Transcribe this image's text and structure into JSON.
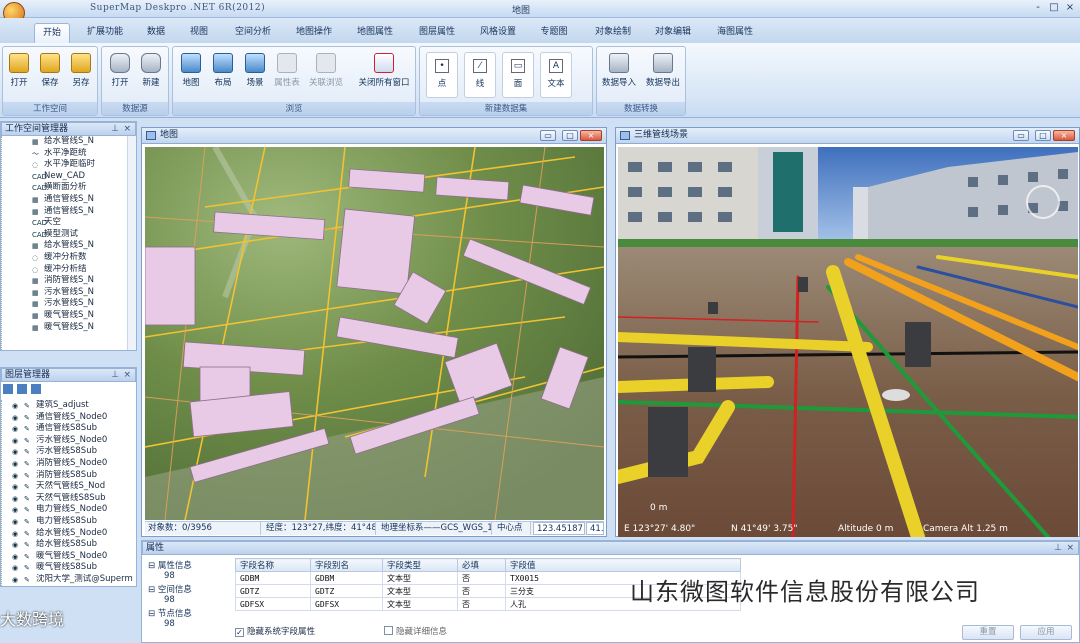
{
  "app": {
    "title": "SuperMap Deskpro .NET 6R(2012)",
    "document": "地图"
  },
  "window_controls": [
    "-",
    "□",
    "×"
  ],
  "menu_tabs": [
    "开始",
    "扩展功能",
    "数据",
    "视图",
    "空间分析",
    "地图操作",
    "地图属性",
    "图层属性",
    "风格设置",
    "专题图",
    "对象绘制",
    "对象编辑",
    "海图属性"
  ],
  "ribbon": {
    "workspace": {
      "label": "工作空间",
      "buttons": [
        "打开",
        "保存",
        "另存"
      ]
    },
    "datasource": {
      "label": "数据源",
      "buttons": [
        "打开",
        "新建"
      ]
    },
    "browse": {
      "label": "浏览",
      "buttons": [
        "地图",
        "布局",
        "场景",
        "属性表",
        "关联浏览",
        "关闭所有窗口"
      ]
    },
    "new_dataset": {
      "label": "新建数据集",
      "buttons": [
        "点",
        "线",
        "面",
        "文本"
      ],
      "icons": [
        "•",
        "⁄",
        "▭",
        "A"
      ]
    },
    "data_convert": {
      "label": "数据转换",
      "buttons": [
        "数据导入",
        "数据导出"
      ]
    }
  },
  "workspace_panel": {
    "title": "工作空间管理器",
    "items": [
      {
        "icon": "▦",
        "label": "给水管线S_N"
      },
      {
        "icon": "〜",
        "label": "水平净距统"
      },
      {
        "icon": "◌",
        "label": "水平净距临时"
      },
      {
        "icon": "CAD",
        "label": "New_CAD"
      },
      {
        "icon": "CAD",
        "label": "横断面分析"
      },
      {
        "icon": "▦",
        "label": "通信管线S_N"
      },
      {
        "icon": "▦",
        "label": "通信管线S_N"
      },
      {
        "icon": "CAD",
        "label": "天空"
      },
      {
        "icon": "CAD",
        "label": "模型测试"
      },
      {
        "icon": "▦",
        "label": "给水管线S_N"
      },
      {
        "icon": "◌",
        "label": "缓冲分析数"
      },
      {
        "icon": "◌",
        "label": "缓冲分析结"
      },
      {
        "icon": "▦",
        "label": "消防管线S_N"
      },
      {
        "icon": "▦",
        "label": "污水管线S_N"
      },
      {
        "icon": "▦",
        "label": "污水管线S_N"
      },
      {
        "icon": "▦",
        "label": "暖气管线S_N"
      },
      {
        "icon": "▦",
        "label": "暖气管线S_N"
      }
    ]
  },
  "layer_panel": {
    "title": "图层管理器",
    "items": [
      "建筑S_adjust",
      "通信管线S_Node0",
      "通信管线S8Sub",
      "污水管线S_Node0",
      "污水管线S8Sub",
      "消防管线S_Node0",
      "消防管线S8Sub",
      "天然气管线S_Nod",
      "天然气管线S8Sub",
      "电力管线S_Node0",
      "电力管线S8Sub",
      "给水管线S_Node0",
      "给水管线S8Sub",
      "暖气管线S_Node0",
      "暖气管线S8Sub",
      "沈阳大学_测试@Superm"
    ]
  },
  "map_window": {
    "title": "地图",
    "status": {
      "count_label": "对象数：",
      "count": "0/3956",
      "coords": "经度：123°27,纬度：41°48",
      "crs_label": "地理坐标系——GCS_WGS_19",
      "center_label": "中心点",
      "center_val": "123.45187190",
      "extra": "41.8"
    }
  },
  "scene_window": {
    "title": "三维管线场景",
    "hud": {
      "scale": "0 m",
      "lon": "E 123°27' 4.80\"",
      "lat": "N 41°49' 3.75\"",
      "alt": "Altitude 0 m",
      "cam": "Camera Alt 1.25 m"
    }
  },
  "attr_panel": {
    "title": "属性",
    "tree": [
      {
        "label": "属性信息",
        "value": "98"
      },
      {
        "label": "空间信息",
        "value": "98"
      },
      {
        "label": "节点信息",
        "value": "98"
      }
    ],
    "columns": [
      "字段名称",
      "字段别名",
      "字段类型",
      "必填",
      "字段值"
    ],
    "rows": [
      [
        "GDBM",
        "GDBM",
        "文本型",
        "否",
        "TX0015"
      ],
      [
        "GDTZ",
        "GDTZ",
        "文本型",
        "否",
        "三分支"
      ],
      [
        "GDFSX",
        "GDFSX",
        "文本型",
        "否",
        "人孔"
      ]
    ],
    "chk_hide_sys": "隐藏系统字段属性",
    "chk_hide_detail": "隐藏详细信息",
    "btn_reset": "重置",
    "btn_apply": "应用"
  },
  "watermark": "山东微图软件信息股份有限公司",
  "watermark_logo": "大数跨境"
}
